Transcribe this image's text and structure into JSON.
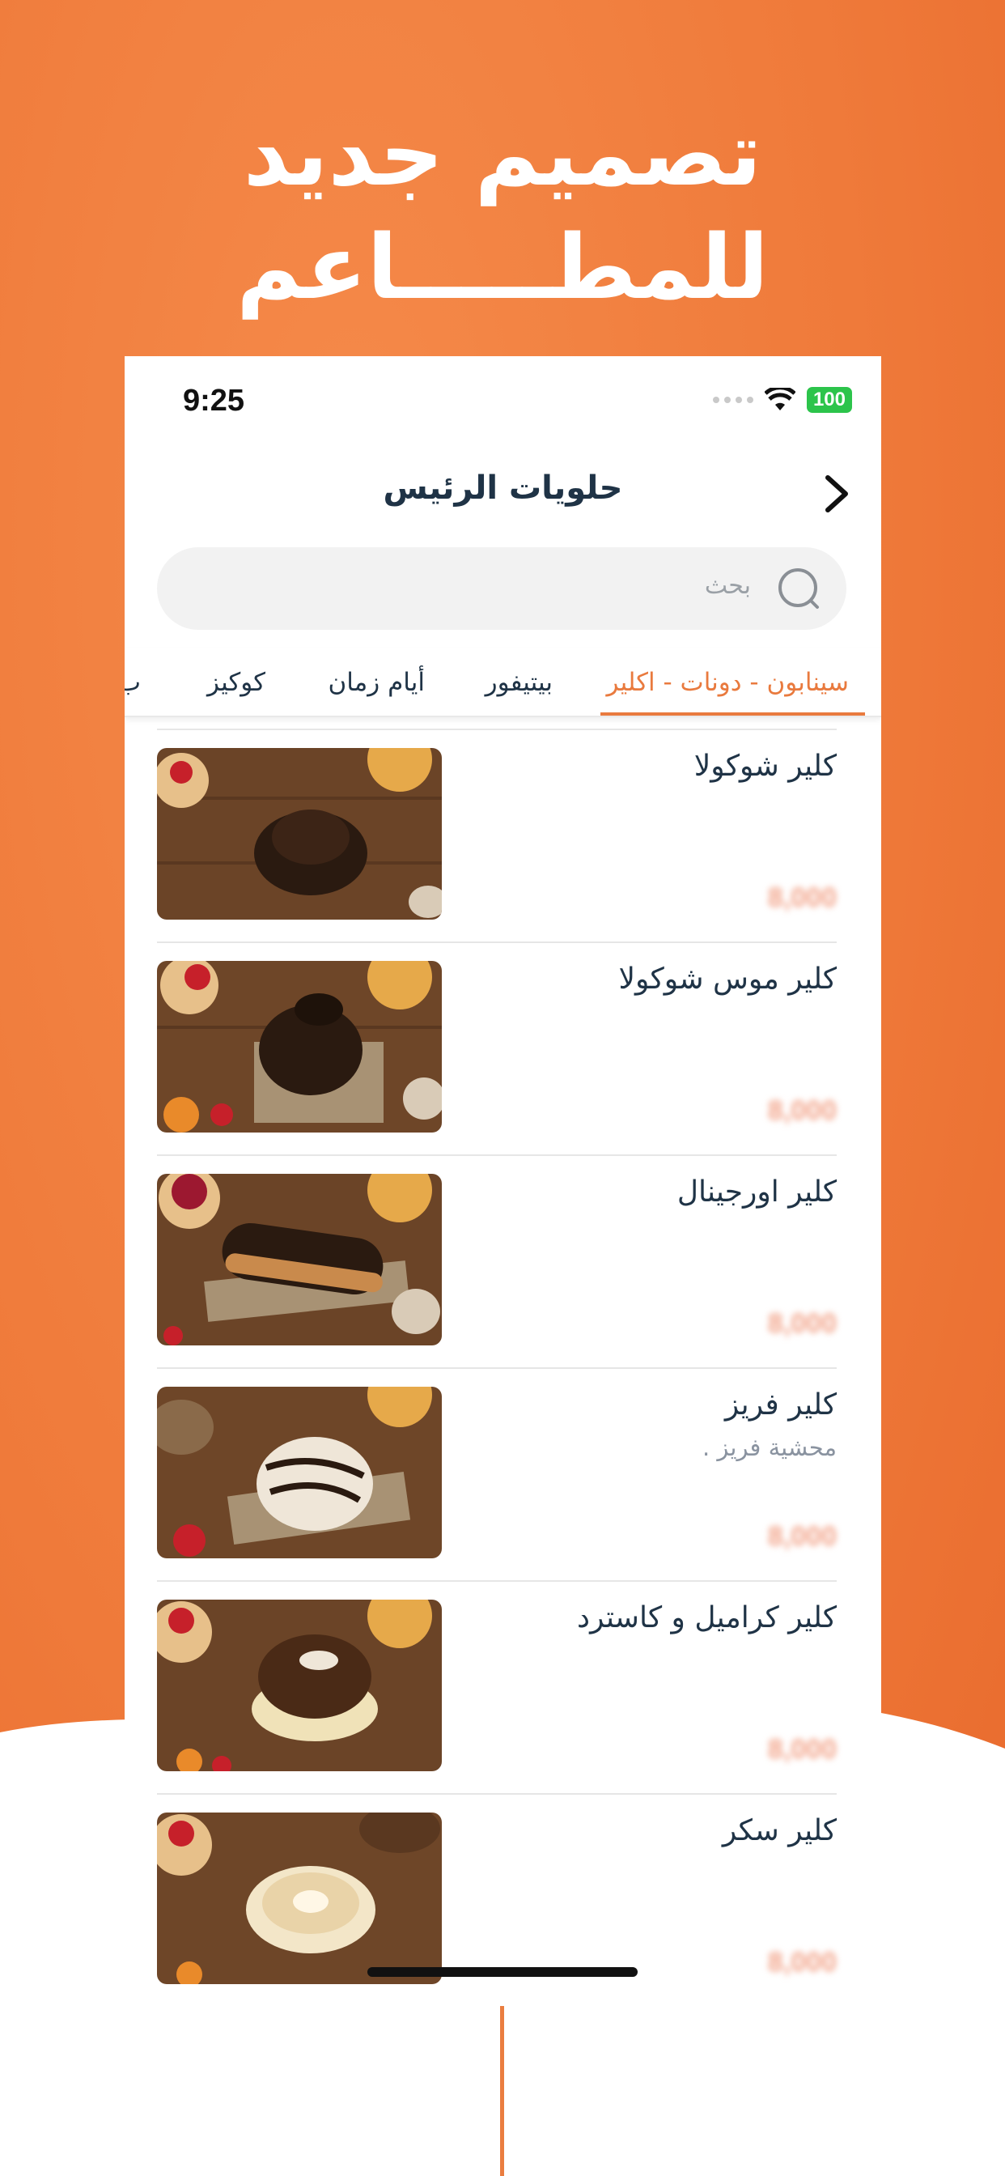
{
  "headline": {
    "line1": "تصميم جديد",
    "line2": "للمطـــــاعم"
  },
  "status_bar": {
    "time": "9:25",
    "battery": "100"
  },
  "nav": {
    "title": "حلويات الرئيس"
  },
  "search": {
    "placeholder": "بحث"
  },
  "tabs": [
    {
      "label": "سينابون - دونات - اكلير",
      "active": true
    },
    {
      "label": "بيتيفور",
      "active": false
    },
    {
      "label": "أيام زمان",
      "active": false
    },
    {
      "label": "كوكيز",
      "active": false
    },
    {
      "label": "ب",
      "active": false
    }
  ],
  "items": [
    {
      "name": "كلير شوكولا",
      "description": "",
      "price": "8,000"
    },
    {
      "name": "كلير موس شوكولا",
      "description": "",
      "price": "8,000"
    },
    {
      "name": "كلير اورجينال",
      "description": "",
      "price": "8,000"
    },
    {
      "name": "كلير فريز",
      "description": "محشية فريز .",
      "price": "8,000"
    },
    {
      "name": "كلير كراميل و كاسترد",
      "description": "",
      "price": "8,000"
    },
    {
      "name": "كلير سكر",
      "description": "",
      "price": "8,000"
    }
  ],
  "colors": {
    "accent": "#e97a3e",
    "background_orange": "#ef7a3a",
    "text_dark": "#1f3346",
    "battery_green": "#2cc44b"
  }
}
